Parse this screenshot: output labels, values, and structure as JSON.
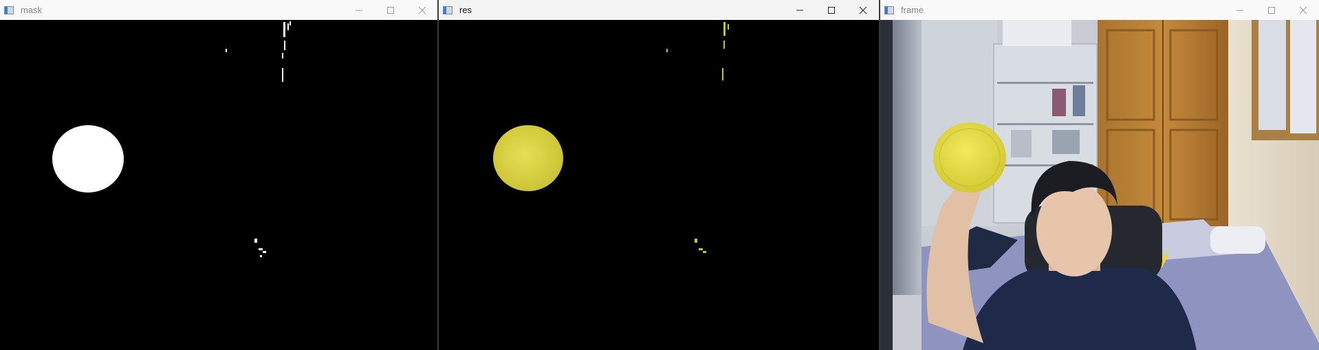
{
  "windows": {
    "mask": {
      "title": "mask",
      "active": false
    },
    "res": {
      "title": "res",
      "active": true
    },
    "frame": {
      "title": "frame",
      "active": false
    }
  },
  "colors": {
    "mask_blob": "#ffffff",
    "res_blob": "#d9d33f",
    "titlebar_active": "#f3f3f3",
    "titlebar_inactive": "#f9f9f9"
  },
  "icons": [
    "opencv-window-icon",
    "minimize-icon",
    "maximize-icon",
    "close-icon"
  ]
}
